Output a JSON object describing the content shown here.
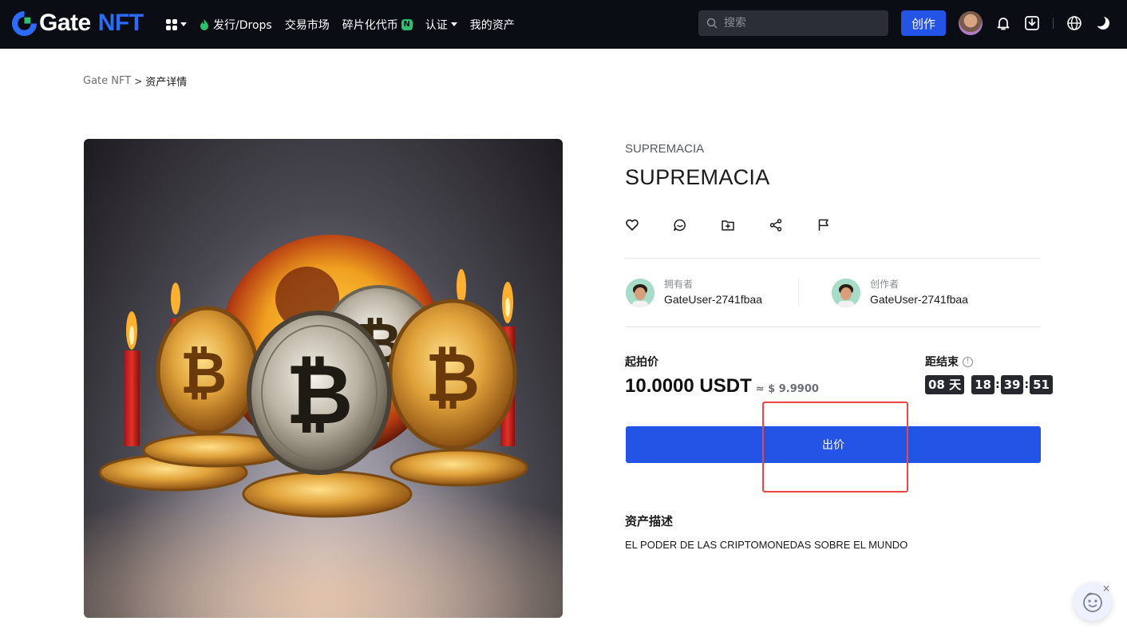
{
  "header": {
    "logo_text_1": "Gate",
    "logo_text_2": "NFT",
    "nav": [
      {
        "label": "发行/Drops"
      },
      {
        "label": "交易市场"
      },
      {
        "label": "碎片化代币",
        "badge": "N"
      },
      {
        "label": "认证"
      },
      {
        "label": "我的资产"
      }
    ],
    "search_placeholder": "搜索",
    "create_label": "创作"
  },
  "breadcrumb": {
    "root": "Gate NFT",
    "separator": ">",
    "current": "资产详情"
  },
  "asset": {
    "collection": "SUPREMACIA",
    "title": "SUPREMACIA",
    "owner_role": "拥有者",
    "owner_name": "GateUser-2741fbaa",
    "creator_role": "创作者",
    "creator_name": "GateUser-2741fbaa",
    "price_label": "起拍价",
    "price": "10.0000 USDT",
    "price_approx": "≈ $ 9.9900",
    "countdown_label": "距结束",
    "countdown": {
      "days": "08",
      "days_unit": "天",
      "hours": "18",
      "minutes": "39",
      "seconds": "51"
    },
    "bid_label": "出价",
    "description_title": "资产描述",
    "description": "EL PODER DE LAS CRIPTOMONEDAS SOBRE EL MUNDO"
  },
  "colors": {
    "primary": "#2354e6",
    "brand_green": "#2fbf71",
    "nav_bg": "#0b0d14",
    "highlight": "#e8474c"
  },
  "icons": [
    "apps-icon",
    "flame-icon",
    "search-icon",
    "bell-icon",
    "download-icon",
    "globe-icon",
    "theme-toggle-icon",
    "heart-icon",
    "comment-icon",
    "folder-add-icon",
    "share-icon",
    "flag-icon",
    "info-icon",
    "support-chat-icon",
    "close-icon"
  ]
}
